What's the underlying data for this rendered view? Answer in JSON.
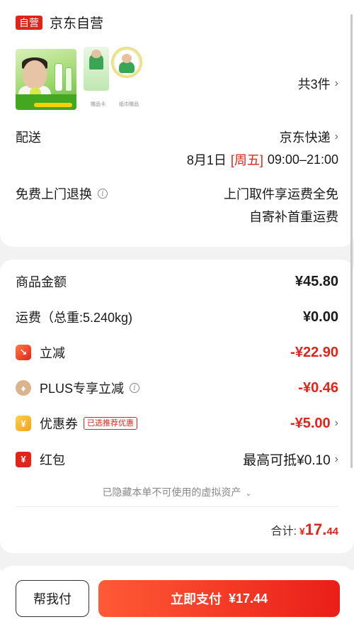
{
  "shop": {
    "badge": "自营",
    "name": "京东自营"
  },
  "products": {
    "count_label": "共3件",
    "img_captions": [
      "赠品卡",
      "纸巾赠品"
    ]
  },
  "delivery": {
    "label": "配送",
    "carrier": "京东快递",
    "date": "8月1日",
    "weekday": "[周五]",
    "time": "09:00–21:00"
  },
  "returns": {
    "label": "免费上门退换",
    "line1": "上门取件享运费全免",
    "line2": "自寄补首重运费"
  },
  "price": {
    "goods_label": "商品金额",
    "goods_value": "¥45.80",
    "shipping_label": "运费（总重:5.240kg)",
    "shipping_value": "¥0.00",
    "discount_label": "立减",
    "discount_value": "-¥22.90",
    "plus_label": "PLUS专享立减",
    "plus_value": "-¥0.46",
    "coupon_label": "优惠券",
    "coupon_tag": "已选推荐优惠",
    "coupon_value": "-¥5.00",
    "hongbao_label": "红包",
    "hongbao_value": "最高可抵¥0.10"
  },
  "hidden_note": "已隐藏本单不可使用的虚拟资产",
  "total": {
    "label": "合计:",
    "currency": "¥",
    "int": "17.",
    "dec": "44"
  },
  "buttons": {
    "help_pay": "帮我付",
    "pay_now": "立即支付",
    "pay_amount": "¥17.44"
  },
  "icons": {
    "discount": "down-arrow-icon",
    "plus": "plus-member-icon",
    "coupon": "coupon-icon",
    "hongbao": "red-envelope-icon"
  },
  "colors": {
    "accent": "#e2231a"
  }
}
